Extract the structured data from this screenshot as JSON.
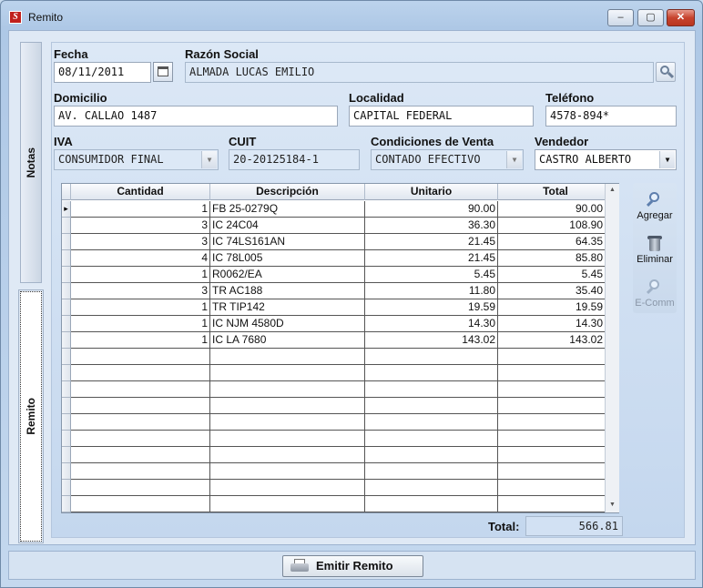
{
  "window": {
    "title": "Remito",
    "minimize": "–",
    "maximize": "▢",
    "close": "✕"
  },
  "tabs": [
    {
      "label": "Notas"
    },
    {
      "label": "Remito"
    }
  ],
  "form": {
    "fecha": {
      "label": "Fecha",
      "value": "08/11/2011"
    },
    "razon_social": {
      "label": "Razón Social",
      "value": "ALMADA LUCAS EMILIO"
    },
    "domicilio": {
      "label": "Domicilio",
      "value": "AV. CALLAO 1487"
    },
    "localidad": {
      "label": "Localidad",
      "value": "CAPITAL FEDERAL"
    },
    "telefono": {
      "label": "Teléfono",
      "value": "4578-894*"
    },
    "iva": {
      "label": "IVA",
      "value": "CONSUMIDOR FINAL"
    },
    "cuit": {
      "label": "CUIT",
      "value": "20-20125184-1"
    },
    "condiciones": {
      "label": "Condiciones de Venta",
      "value": "CONTADO EFECTIVO"
    },
    "vendedor": {
      "label": "Vendedor",
      "value": "CASTRO ALBERTO"
    }
  },
  "grid": {
    "columns": [
      "Cantidad",
      "Descripción",
      "Unitario",
      "Total"
    ],
    "rows": [
      [
        "1",
        "FB 25-0279Q",
        "90.00",
        "90.00"
      ],
      [
        "3",
        "IC 24C04",
        "36.30",
        "108.90"
      ],
      [
        "3",
        "IC 74LS161AN",
        "21.45",
        "64.35"
      ],
      [
        "4",
        "IC 78L005",
        "21.45",
        "85.80"
      ],
      [
        "1",
        "R0062/EA",
        "5.45",
        "5.45"
      ],
      [
        "3",
        "TR AC188",
        "11.80",
        "35.40"
      ],
      [
        "1",
        "TR TIP142",
        "19.59",
        "19.59"
      ],
      [
        "1",
        "IC NJM 4580D",
        "14.30",
        "14.30"
      ],
      [
        "1",
        "IC LA 7680",
        "143.02",
        "143.02"
      ]
    ],
    "current_row_marker": "▸"
  },
  "actions": {
    "agregar": "Agregar",
    "eliminar": "Eliminar",
    "ecomm": "E-Comm"
  },
  "total": {
    "label": "Total:",
    "value": "566.81"
  },
  "footer": {
    "emit_label": "Emitir Remito"
  }
}
